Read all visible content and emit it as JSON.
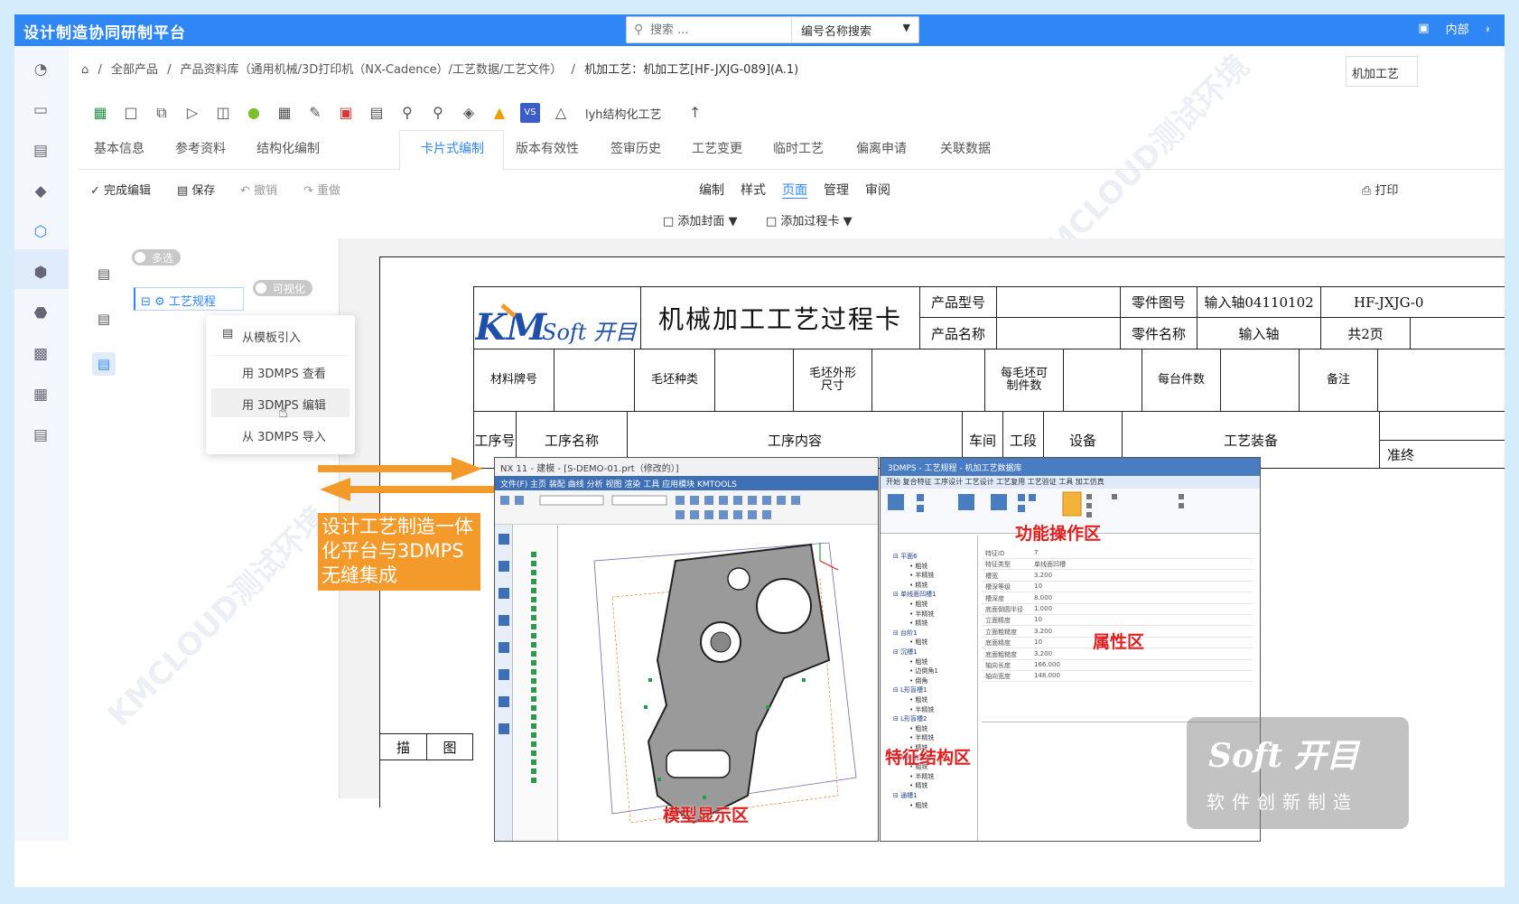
{
  "app": {
    "title": "设计制造协同研制平台"
  },
  "search": {
    "placeholder": "搜索 ...",
    "mode": "编号名称搜索"
  },
  "topright": {
    "label": "内部"
  },
  "breadcrumb": {
    "items": [
      "全部产品",
      "产品资料库（通用机械/3D打印机（NX-Cadence）/工艺数据/工艺文件）",
      "机加工艺：机加工艺[HF-JXJG-089](A.1)"
    ]
  },
  "right_tab": "机加工艺",
  "toolbar": {
    "structured_label": "lyh结构化工艺"
  },
  "tabs": [
    "基本信息",
    "参考资料",
    "结构化编制",
    "卡片式编制",
    "版本有效性",
    "签审历史",
    "工艺变更",
    "临时工艺",
    "偏离申请",
    "关联数据"
  ],
  "edit_actions": {
    "done": "完成编辑",
    "save": "保存",
    "undo": "撤销",
    "redo": "重做",
    "print": "打印"
  },
  "mode_tabs": [
    "编制",
    "样式",
    "页面",
    "管理",
    "审阅"
  ],
  "add_buttons": {
    "cover": "添加封面",
    "process_card": "添加过程卡"
  },
  "tree": {
    "multi_select": "多选",
    "visualize": "可视化",
    "node": "工艺规程"
  },
  "context_menu": [
    "从模板引入",
    "用 3DMPS 查看",
    "用 3DMPS 编辑",
    "从 3DMPS 导入"
  ],
  "card": {
    "logo_text": "Soft 开目",
    "title": "机械加工工艺过程卡",
    "product_model_label": "产品型号",
    "product_name_label": "产品名称",
    "part_no_label": "零件图号",
    "part_no_value": "输入轴04110102",
    "part_name_label": "零件名称",
    "part_name_value": "输入轴",
    "doc_no": "HF-JXJG-0",
    "pages": "共2页",
    "row2": [
      "材料牌号",
      "毛坯种类",
      "毛坯外形尺寸",
      "每毛坯可制件数",
      "每台件数",
      "备注"
    ],
    "row3": [
      "工序号",
      "工序名称",
      "工序内容",
      "车间",
      "工段",
      "设备",
      "工艺装备"
    ],
    "approve": "准终",
    "bottom_left": "描",
    "bottom_right": "图"
  },
  "callout": "设计工艺制造一体化平台与3DMPS无缝集成",
  "nx": {
    "title": "NX  11 - 建模 - [S-DEMO-01.prt（修改的）]",
    "menu": "文件(F)   主页   装配   曲线   分析   视图   渲染   工具   应用模块   KMTOOLS"
  },
  "kmcaps": {
    "title": "3DMPS - 工艺规程 - 机加工艺数据库",
    "tabs": "开始   复合特征   工序设计   工艺设计   工艺复用   工艺验证   工具   加工仿真",
    "props": [
      [
        "特征ID",
        "7"
      ],
      [
        "特征类型",
        "单线面凹槽"
      ],
      [
        "槽宽",
        "3.200"
      ],
      [
        "槽深等级",
        "10"
      ],
      [
        "槽深度",
        "8.000"
      ],
      [
        "底面倒圆半径",
        "1.000"
      ],
      [
        "立面精度",
        "10"
      ],
      [
        "立面粗糙度",
        "3.200"
      ],
      [
        "底面精度",
        "10"
      ],
      [
        "底面粗糙度",
        "3.200"
      ],
      [
        "轴向长度",
        "166.000"
      ],
      [
        "轴向宽度",
        "148.000"
      ]
    ],
    "tree": [
      "平面6",
      "粗铣",
      "半精铣",
      "精铣",
      "单线面凹槽1",
      "粗铣",
      "半精铣",
      "精铣",
      "台阶1",
      "粗铣",
      "沉槽1",
      "粗铣",
      "边倒角1",
      "倒角",
      "L形盲槽1",
      "粗铣",
      "半精铣",
      "L形盲槽2",
      "粗铣",
      "半精铣",
      "精铣",
      "阶形底凹槽2",
      "粗铣",
      "半精铣",
      "精铣",
      "通槽1",
      "粗铣"
    ]
  },
  "zones": {
    "function": "功能操作区",
    "property": "属性区",
    "feature": "特征结构区",
    "model": "模型显示区"
  },
  "brand": {
    "logo": "Soft 开目",
    "slogan": "软件创新制造"
  },
  "watermark": "KMCLOUD测试环境",
  "colors": {
    "primary": "#2f86f5",
    "accent": "#f39a2b",
    "zone_label": "#e02020"
  }
}
